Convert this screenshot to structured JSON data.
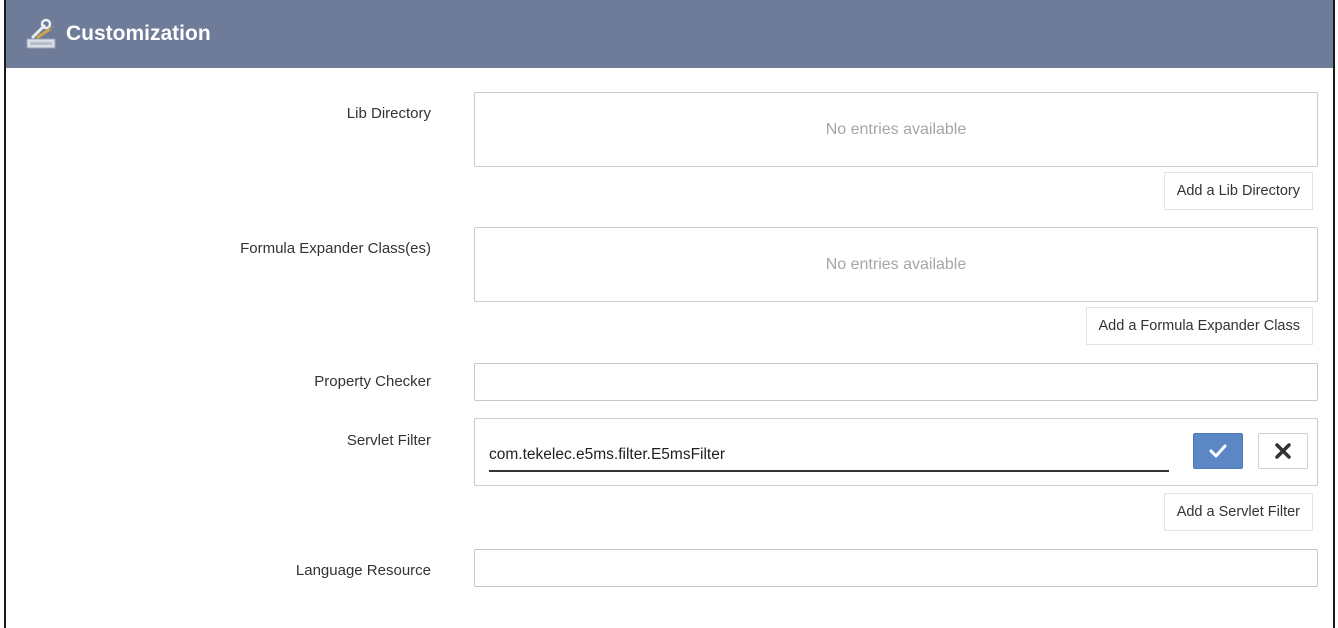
{
  "header": {
    "title": "Customization",
    "icon": "tools-icon"
  },
  "fields": {
    "lib_directory": {
      "label": "Lib Directory",
      "empty_text": "No entries available",
      "add_label": "Add a Lib Directory"
    },
    "formula_expander": {
      "label": "Formula Expander Class(es)",
      "empty_text": "No entries available",
      "add_label": "Add a Formula Expander Class"
    },
    "property_checker": {
      "label": "Property Checker",
      "value": ""
    },
    "servlet_filter": {
      "label": "Servlet Filter",
      "value": "com.tekelec.e5ms.filter.E5msFilter",
      "add_label": "Add a Servlet Filter",
      "confirm_icon": "check-icon",
      "cancel_icon": "close-icon"
    },
    "language_resource": {
      "label": "Language Resource",
      "value": ""
    }
  },
  "colors": {
    "header_bg": "#6e7b99",
    "confirm_bg": "#5b87c4"
  }
}
